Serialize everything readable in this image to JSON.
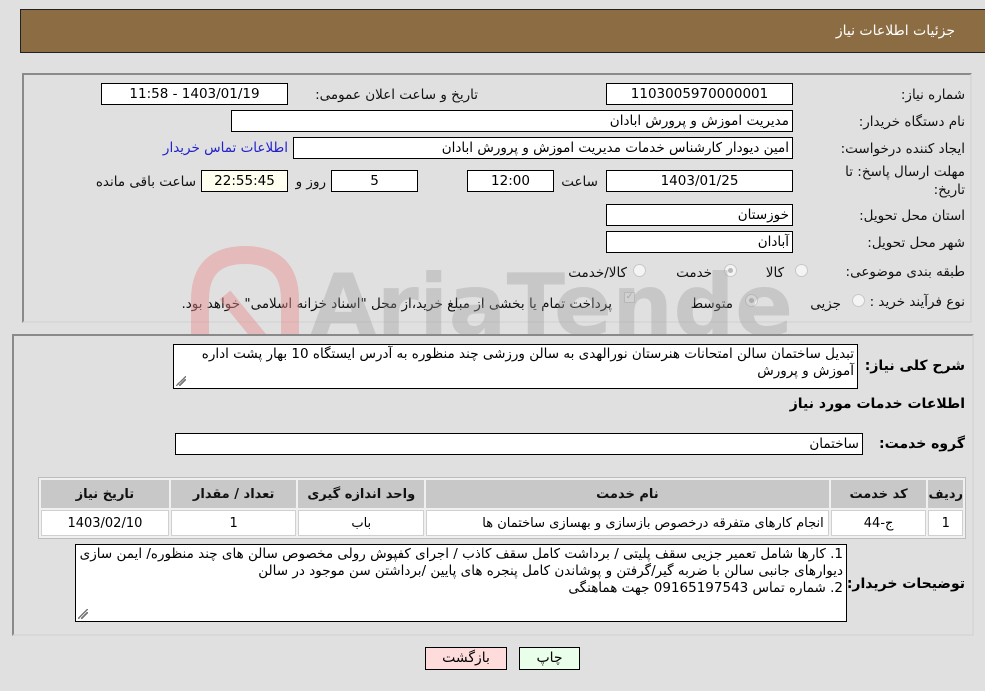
{
  "header": {
    "title": "جزئیات اطلاعات نیاز"
  },
  "fields": {
    "need_number": {
      "label": "شماره نیاز:",
      "value": "1103005970000001"
    },
    "announce_datetime": {
      "label": "تاریخ و ساعت اعلان عمومی:",
      "value": "1403/01/19 - 11:58"
    },
    "buyer_org": {
      "label": "نام دستگاه خریدار:",
      "value": "مدیریت اموزش و پرورش ابادان"
    },
    "requester": {
      "label": "ایجاد کننده درخواست:",
      "value": "امین دیودار کارشناس خدمات مدیریت اموزش و پرورش ابادان"
    },
    "buyer_contact_link": "اطلاعات تماس خریدار",
    "deadline": {
      "label_line1": "مهلت ارسال پاسخ: تا",
      "label_line2": "تاریخ:",
      "date": "1403/01/25",
      "time_label": "ساعت",
      "time": "12:00",
      "days": "5",
      "days_label": "روز و",
      "remaining": "22:55:45",
      "remaining_label": "ساعت باقی مانده"
    },
    "province": {
      "label": "استان محل تحویل:",
      "value": "خوزستان"
    },
    "city": {
      "label": "شهر محل تحویل:",
      "value": "آبادان"
    },
    "category": {
      "label": "طبقه بندی موضوعی:",
      "options": [
        "کالا",
        "خدمت",
        "کالا/خدمت"
      ],
      "selected": "خدمت"
    },
    "purchase_process": {
      "label": "نوع فرآیند خرید :",
      "options": [
        "جزیی",
        "متوسط"
      ],
      "selected": "متوسط",
      "treasury_note": "پرداخت تمام یا بخشی از مبلغ خرید،از محل \"اسناد خزانه اسلامی\" خواهد بود."
    }
  },
  "description": {
    "label": "شرح کلی نیاز:",
    "value": "تبدیل ساختمان سالن امتحانات هنرستان نورالهدی به سالن ورزشی چند منظوره به آدرس ایستگاه 10 بهار پشت اداره آموزش و پرورش"
  },
  "services_section": {
    "title": "اطلاعات خدمات مورد نیاز",
    "group_label": "گروه خدمت:",
    "group_value": "ساختمان",
    "table": {
      "headers": [
        "ردیف",
        "کد خدمت",
        "نام خدمت",
        "واحد اندازه گیری",
        "تعداد / مقدار",
        "تاریخ نیاز"
      ],
      "rows": [
        [
          "1",
          "ج-44",
          "انجام کارهای متفرقه درخصوص بازسازی و بهسازی ساختمان ها",
          "باب",
          "1",
          "1403/02/10"
        ]
      ]
    }
  },
  "buyer_notes": {
    "label": "توضیحات خریدار:",
    "lines": [
      "1. کارها شامل تعمیر جزیی سقف پلیتی / برداشت کامل سقف کاذب / اجرای کفپوش رولی مخصوص سالن های چند منظوره/ ایمن سازی دیوارهای جانبی سالن با ضربه گیر/گرفتن و پوشاندن کامل پنجره های پایین /برداشتن سن موجود در سالن",
      "2. شماره تماس 09165197543 جهت هماهنگی"
    ]
  },
  "buttons": {
    "print": "چاپ",
    "back": "بازگشت"
  },
  "watermark": "AriaTender.neT",
  "colors": {
    "header_bg": "#8c6d43",
    "print_btn_bg": "#eaffea",
    "back_btn_bg": "#ffdcdc",
    "link": "#2222cc"
  }
}
